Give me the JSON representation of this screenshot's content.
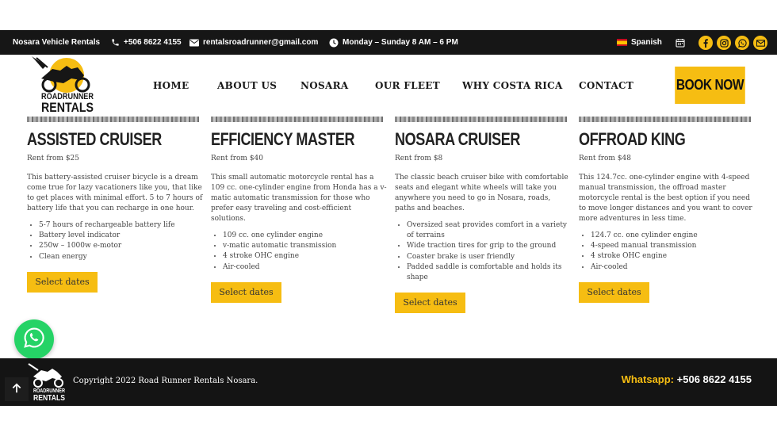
{
  "topbar": {
    "brand": "Nosara Vehicle Rentals",
    "phone": "+506 8622 4155",
    "email": "rentalsroadrunner@gmail.com",
    "hours": "Monday – Sunday 8 AM – 6 PM",
    "language": "Spanish",
    "icons": [
      "phone-icon",
      "mail-icon",
      "clock-icon",
      "flag-spain-icon",
      "calendar-icon",
      "facebook-icon",
      "instagram-icon",
      "whatsapp-icon",
      "mail-icon"
    ]
  },
  "header": {
    "logo_text_top": "ROADRUNNER",
    "logo_text_bottom": "RENTALS",
    "nav": [
      "HOME",
      "ABOUT US",
      "NOSARA",
      "OUR FLEET",
      "WHY COSTA RICA",
      "CONTACT"
    ],
    "cta": "BOOK NOW"
  },
  "products": [
    {
      "title": "ASSISTED CRUISER",
      "price": "Rent from $25",
      "description": "This battery-assisted cruiser bicycle is a dream come true for lazy vacationers like you, that like to get places with minimal effort. 5 to 7 hours of battery life that you can recharge in one hour.",
      "features": [
        "5-7 hours of rechargeable battery life",
        "Battery level indicator",
        "250w – 1000w e-motor",
        "Clean energy"
      ],
      "button": "Select dates"
    },
    {
      "title": "EFFICIENCY MASTER",
      "price": "Rent from $40",
      "description": "This small automatic motorcycle rental has a 109 cc. one-cylinder engine from Honda has a v-matic automatic transmission for those who prefer easy traveling and cost-efficient solutions.",
      "features": [
        "109 cc. one cylinder engine",
        "v-matic automatic transmission",
        "4 stroke OHC engine",
        "Air-cooled"
      ],
      "button": "Select dates"
    },
    {
      "title": "NOSARA CRUISER",
      "price": "Rent from $8",
      "description": "The classic beach cruiser bike with comfortable seats and elegant white wheels will take you anywhere you need to go in Nosara, roads, paths and beaches.",
      "features": [
        "Oversized seat provides comfort in a variety of terrains",
        "Wide traction tires for grip to the ground",
        "Coaster brake is user friendly",
        "Padded saddle is comfortable and holds its shape"
      ],
      "button": "Select dates"
    },
    {
      "title": "OFFROAD KING",
      "price": "Rent from $48",
      "description": "This 124.7cc. one-cylinder engine with 4-speed manual transmission, the offroad master motorcycle rental is the best option if you need to move longer distances and you want to cover more adventures in less time.",
      "features": [
        "124.7 cc. one cylinder engine",
        "4-speed manual transmission",
        "4 stroke OHC engine",
        "Air-cooled"
      ],
      "button": "Select dates"
    }
  ],
  "footer": {
    "copyright": "Copyright 2022 Road Runner Rentals Nosara.",
    "whatsapp_label": "Whatsapp:",
    "whatsapp_number": "+506 8622 4155"
  },
  "colors": {
    "accent": "#f6bd12",
    "dark": "#161616",
    "whatsapp": "#25d366"
  }
}
